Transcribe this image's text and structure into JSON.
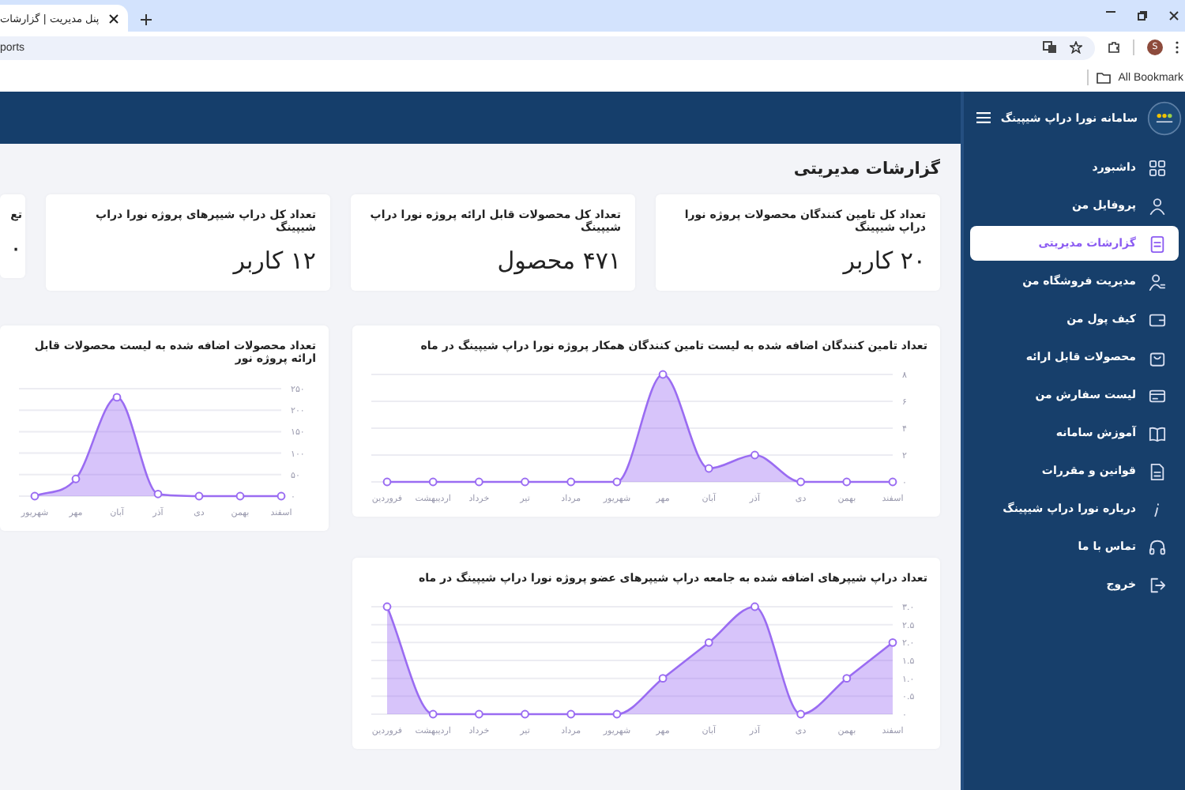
{
  "browser": {
    "tab_title": "پنل مدیریت | گزارشات",
    "address": "ports",
    "avatar_letter": "S",
    "bookmarks": "All Bookmark"
  },
  "sidebar": {
    "title": "سامانه نورا دراپ شیپینگ",
    "items": [
      {
        "label": "داشبورد",
        "selected": false
      },
      {
        "label": "پروفایل من",
        "selected": false
      },
      {
        "label": "گزارشات مدیریتی",
        "selected": true
      },
      {
        "label": "مدیریت فروشگاه من",
        "selected": false
      },
      {
        "label": "کیف پول من",
        "selected": false
      },
      {
        "label": "محصولات قابل ارائه",
        "selected": false
      },
      {
        "label": "لیست سفارش من",
        "selected": false
      },
      {
        "label": "آموزش سامانه",
        "selected": false
      },
      {
        "label": "قوانین و مقررات",
        "selected": false
      },
      {
        "label": "درباره نورا دراپ شیپینگ",
        "selected": false
      },
      {
        "label": "تماس با ما",
        "selected": false
      },
      {
        "label": "خروج",
        "selected": false
      }
    ]
  },
  "page_title": "گزارشات مدیریتی",
  "stat_cards": [
    {
      "title": "تعداد کل تامین کنندگان محصولات پروژه نورا دراپ شیپینگ",
      "value": "۲۰ کاربر"
    },
    {
      "title": "تعداد کل محصولات قابل ارائه پروژه نورا دراپ شیپینگ",
      "value": "۴۷۱ محصول"
    },
    {
      "title": "تعداد کل دراپ شیپرهای پروژه نورا دراپ شیپینگ",
      "value": "۱۲ کاربر"
    },
    {
      "title": "تع",
      "value": "۰"
    }
  ],
  "charts": [
    {
      "title": "تعداد تامین کنندگان اضافه شده به لیست تامین کنندگان همکار پروژه نورا دراپ شیپینگ در ماه",
      "chart_data": {
        "type": "area",
        "grid": true,
        "categories": [
          "فروردین",
          "اردیبهشت",
          "خرداد",
          "تیر",
          "مرداد",
          "شهریور",
          "مهر",
          "آبان",
          "آذر",
          "دی",
          "بهمن",
          "اسفند"
        ],
        "ylim": [
          0,
          8
        ],
        "yticks": [
          {
            "value": 0,
            "label": "۰"
          },
          {
            "value": 2,
            "label": "۲"
          },
          {
            "value": 4,
            "label": "۴"
          },
          {
            "value": 6,
            "label": "۶"
          },
          {
            "value": 8,
            "label": "۸"
          }
        ],
        "series": [
          {
            "color": "#9a6cf2",
            "values": [
              0,
              0,
              0,
              0,
              0,
              0,
              8,
              1,
              2,
              0,
              0,
              0
            ]
          }
        ]
      }
    },
    {
      "title": "تعداد محصولات اضافه شده به لیست محصولات قابل ارائه پروژه نور",
      "chart_data": {
        "type": "area",
        "grid": true,
        "categories": [
          "شهریور",
          "مهر",
          "آبان",
          "آذر",
          "دی",
          "بهمن",
          "اسفند"
        ],
        "ylim": [
          0,
          250
        ],
        "yticks": [
          {
            "value": 0,
            "label": "۰"
          },
          {
            "value": 50,
            "label": "۵۰"
          },
          {
            "value": 100,
            "label": "۱۰۰"
          },
          {
            "value": 150,
            "label": "۱۵۰"
          },
          {
            "value": 200,
            "label": "۲۰۰"
          },
          {
            "value": 250,
            "label": "۲۵۰"
          }
        ],
        "series": [
          {
            "color": "#9a6cf2",
            "values": [
              0,
              40,
              230,
              5,
              0,
              0,
              0
            ]
          }
        ]
      }
    },
    {
      "title": "تعداد دراپ شیپرهای اضافه شده به جامعه دراپ شیپرهای عضو پروژه نورا دراپ شیپینگ در ماه",
      "chart_data": {
        "type": "area",
        "grid": true,
        "categories": [
          "فروردین",
          "اردیبهشت",
          "خرداد",
          "تیر",
          "مرداد",
          "شهریور",
          "مهر",
          "آبان",
          "آذر",
          "دی",
          "بهمن",
          "اسفند"
        ],
        "ylim": [
          0,
          3
        ],
        "yticks": [
          {
            "value": 0,
            "label": "۰"
          },
          {
            "value": 0.5,
            "label": "۰.۵"
          },
          {
            "value": 1,
            "label": "۱.۰"
          },
          {
            "value": 1.5,
            "label": "۱.۵"
          },
          {
            "value": 2,
            "label": "۲.۰"
          },
          {
            "value": 2.5,
            "label": "۲.۵"
          },
          {
            "value": 3,
            "label": "۳.۰"
          }
        ],
        "series": [
          {
            "color": "#9a6cf2",
            "values": [
              3,
              0,
              0,
              0,
              0,
              0,
              1,
              2,
              3,
              0,
              1,
              2
            ]
          }
        ]
      }
    }
  ]
}
